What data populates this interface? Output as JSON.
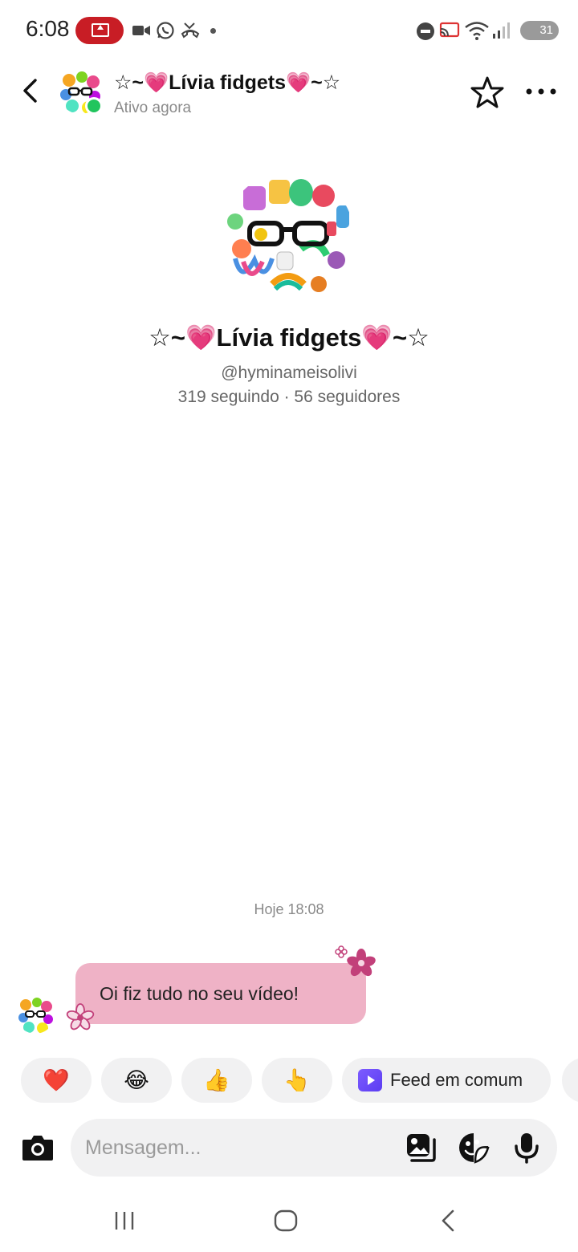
{
  "status_bar": {
    "time": "6:08",
    "battery": "31"
  },
  "header": {
    "name": "☆~💗Lívia fidgets💗~☆",
    "status": "Ativo agora"
  },
  "profile": {
    "name": "☆~💗Lívia fidgets💗~☆",
    "handle": "@hyminameisolivi",
    "stats": "319 seguindo · 56 seguidores"
  },
  "conversation": {
    "timestamp": "Hoje 18:08",
    "messages": [
      {
        "text": "Oi fiz tudo no seu vídeo!"
      }
    ]
  },
  "quick_replies": {
    "emojis": [
      "❤️",
      "😂",
      "👍",
      "👆"
    ],
    "feed_label": "Feed em comum"
  },
  "compose": {
    "placeholder": "Mensagem..."
  },
  "colors": {
    "bubble": "#efb2c6",
    "online": "#21c55d",
    "record": "#c81d25",
    "chip": "#f1f1f2"
  }
}
